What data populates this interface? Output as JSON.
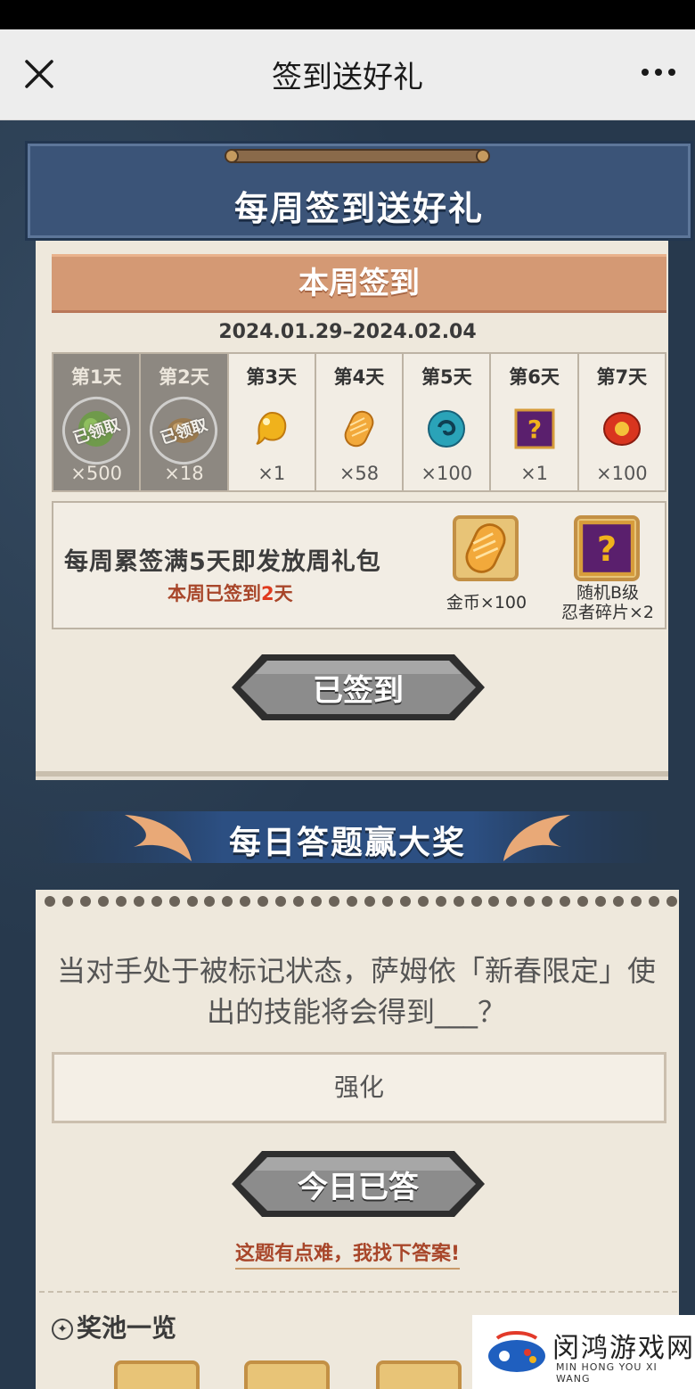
{
  "topbar": {
    "title": "签到送好礼"
  },
  "weekly_signin": {
    "banner_title": "每周签到送好礼",
    "section_title": "本周签到",
    "date_range": "2024.01.29–2024.02.04",
    "days": [
      {
        "label": "第1天",
        "qty": "×500",
        "claimed": true,
        "stamp": "已领取",
        "icon": "green-item-icon"
      },
      {
        "label": "第2天",
        "qty": "×18",
        "claimed": true,
        "stamp": "已领取",
        "icon": "brown-item-icon"
      },
      {
        "label": "第3天",
        "qty": "×1",
        "claimed": false,
        "icon": "gold-drop-icon"
      },
      {
        "label": "第4天",
        "qty": "×58",
        "claimed": false,
        "icon": "gold-coin-icon"
      },
      {
        "label": "第5天",
        "qty": "×100",
        "claimed": false,
        "icon": "blue-orb-icon"
      },
      {
        "label": "第6天",
        "qty": "×1",
        "claimed": false,
        "icon": "mystery-shard-icon"
      },
      {
        "label": "第7天",
        "qty": "×100",
        "claimed": false,
        "icon": "red-scroll-icon"
      }
    ],
    "weekly_text": "每周累签满5天即发放周礼包",
    "weekly_progress_prefix": "本周已签到",
    "weekly_progress_count": "2",
    "weekly_progress_suffix": "天",
    "rewards": [
      {
        "label": "金币×100",
        "icon": "gold-coin-icon"
      },
      {
        "label_line1": "随机B级",
        "label_line2": "忍者碎片×2",
        "icon": "mystery-shard-icon"
      }
    ],
    "button_label": "已签到"
  },
  "daily_quiz": {
    "title": "每日答题赢大奖",
    "question": "当对手处于被标记状态，萨姆依「新春限定」使出的技能将会得到___？",
    "answer": "强化",
    "button_label": "今日已答",
    "hint": "这题有点难，我找下答案!",
    "pool_title": "奖池一览"
  },
  "watermark": {
    "title": "闵鸿游戏网",
    "subtitle": "MIN HONG YOU XI WANG"
  },
  "colors": {
    "banner": "#3b5478",
    "paper": "#eee8dc",
    "accent": "#d49974",
    "highlight": "#e03a1e"
  }
}
